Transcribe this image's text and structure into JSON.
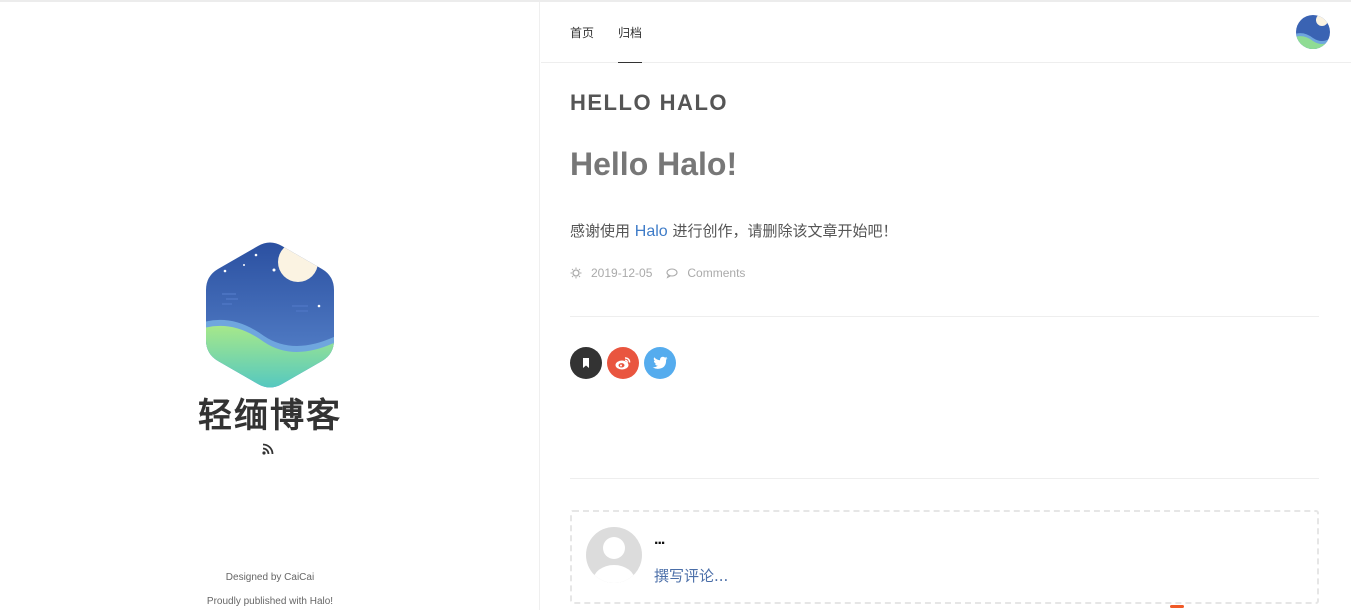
{
  "site": {
    "title": "轻缅博客",
    "footer_designed": "Designed by CaiCai",
    "footer_published": "Proudly published with Halo!"
  },
  "nav": {
    "items": [
      {
        "label": "首页",
        "active": false
      },
      {
        "label": "归档",
        "active": true
      }
    ]
  },
  "post": {
    "section_title": "HELLO HALO",
    "title": "Hello Halo!",
    "body_before": "感谢使用 ",
    "body_link": "Halo",
    "body_after": " 进行创作，请删除该文章开始吧！",
    "date": "2019-12-05",
    "comments_label": "Comments"
  },
  "share": {
    "icons": [
      "bookmark-icon",
      "weibo-icon",
      "twitter-icon"
    ],
    "colors": {
      "bookmark": "#333333",
      "weibo": "#e9553f",
      "twitter": "#55acee"
    }
  },
  "comment": {
    "name": "...",
    "placeholder": "撰写评论..."
  },
  "colors": {
    "link": "#3f7cc8",
    "text": "#555555"
  }
}
